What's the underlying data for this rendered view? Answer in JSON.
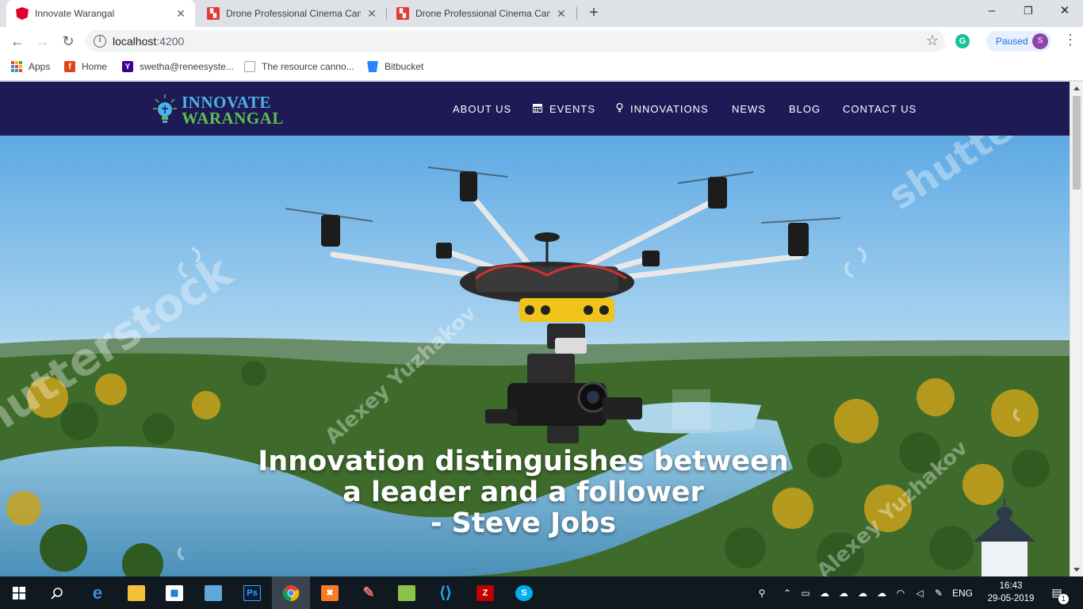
{
  "browser": {
    "tabs": [
      {
        "title": "Innovate Warangal",
        "icon": "angular-icon",
        "active": true
      },
      {
        "title": "Drone Professional Cinema Came",
        "icon": "pdf-icon",
        "active": false
      },
      {
        "title": "Drone Professional Cinema Came",
        "icon": "pdf-icon",
        "active": false
      }
    ],
    "new_tab": "+",
    "window_controls": {
      "minimize": "–",
      "restore": "❐",
      "close": "✕"
    },
    "url_host": "localhost",
    "url_port": ":4200",
    "extension_letter": "G",
    "profile": {
      "label": "Paused",
      "initial": "S"
    },
    "bookmarks": [
      {
        "label": "Apps",
        "icon": "apps-grid-icon"
      },
      {
        "label": "Home",
        "icon": "home-bookmark-icon"
      },
      {
        "label": "swetha@reneesyste...",
        "icon": "yahoo-icon"
      },
      {
        "label": "The resource canno...",
        "icon": "page-icon"
      },
      {
        "label": "Bitbucket",
        "icon": "bitbucket-icon"
      }
    ]
  },
  "site": {
    "logo": {
      "line1": "INNOVATE",
      "line2": "WARANGAL"
    },
    "nav": [
      {
        "label": "ABOUT US",
        "icon": ""
      },
      {
        "label": "EVENTS",
        "icon": "calendar-icon"
      },
      {
        "label": "INNOVATIONS",
        "icon": "lightbulb-icon"
      },
      {
        "label": "NEWS",
        "icon": ""
      },
      {
        "label": "BLOG",
        "icon": ""
      },
      {
        "label": "CONTACT US",
        "icon": ""
      }
    ],
    "hero": {
      "quote_line1": "Innovation distinguishes between",
      "quote_line2": "a leader and a follower",
      "quote_line3": "- Steve Jobs",
      "watermarks": [
        "shutterstock",
        "Alexey Yuzhakov"
      ]
    }
  },
  "taskbar": {
    "apps": [
      "windows-start-icon",
      "search-icon",
      "edge-icon",
      "file-explorer-icon",
      "store-icon",
      "control-panel-icon",
      "photoshop-icon",
      "chrome-icon",
      "xampp-icon",
      "paint-icon",
      "notepad-plus-icon",
      "vscode-icon",
      "filezilla-icon",
      "skype-icon"
    ],
    "language": "ENG",
    "time": "16:43",
    "date": "29-05-2019",
    "notification_count": "1"
  },
  "colors": {
    "nav_bg": "#1f1a55",
    "logo_blue": "#4bb4e6",
    "logo_green": "#5cc04a",
    "taskbar_bg": "#101820"
  }
}
